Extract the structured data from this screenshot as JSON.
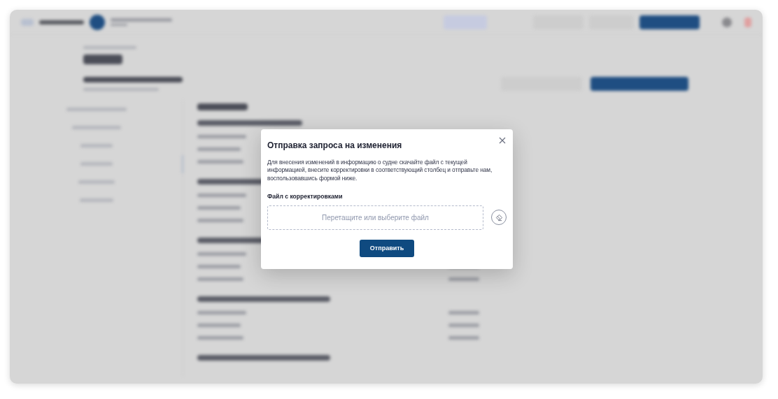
{
  "dialog": {
    "title": "Отправка запроса на изменения",
    "description": "Для внесения изменений в информацию о судне скачайте файл с текущей информацией, внесите корректировки в соответствующий столбец и отправьте нам, воспользовавшись формой ниже.",
    "file_label": "Файл с корректировками",
    "dropzone_hint": "Перетащите или выберите файл",
    "submit_button": "Отправить"
  }
}
